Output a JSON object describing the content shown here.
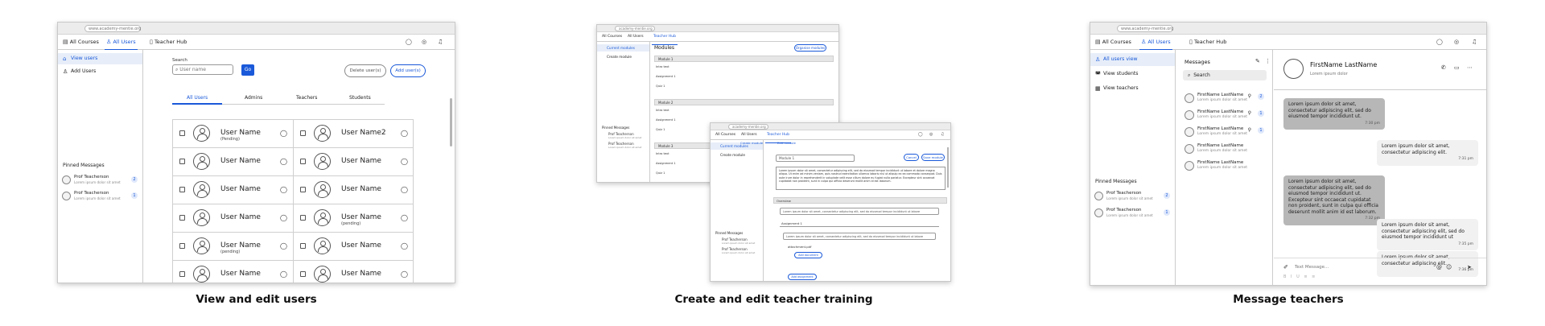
{
  "panels": [
    {
      "caption": "View and edit users"
    },
    {
      "caption": "Create and edit teacher training"
    },
    {
      "caption": "Message teachers"
    }
  ],
  "browser": {
    "url": "www.academy-mentie.org"
  },
  "topnav": {
    "all_courses": "All Courses",
    "all_users": "All Users",
    "teacher_hub": "Teacher Hub"
  },
  "users_panel": {
    "sidebar": {
      "view_users": "View users",
      "add_users": "Add Users"
    },
    "pinned_title": "Pinned Messages",
    "pinned": [
      {
        "name": "Prof Teacherson",
        "sub": "Lorem ipsum dolor sit amet",
        "count": "2"
      },
      {
        "name": "Prof Teacherson",
        "sub": "Lorem ipsum dolor sit amet",
        "count": "1"
      }
    ],
    "search_label": "Search",
    "search_placeholder": "User name",
    "go": "Go",
    "delete_btn": "Delete user(s)",
    "add_btn": "Add user(s)",
    "subtabs": [
      "All Users",
      "Admins",
      "Teachers",
      "Students"
    ],
    "left_col": [
      {
        "name": "User Name",
        "status": "(Pending)"
      },
      {
        "name": "User Name",
        "status": ""
      },
      {
        "name": "User Name",
        "status": ""
      },
      {
        "name": "User Name",
        "status": ""
      },
      {
        "name": "User Name",
        "status": "(pending)"
      },
      {
        "name": "User Name",
        "status": ""
      }
    ],
    "right_col": [
      {
        "name": "User Name2",
        "status": ""
      },
      {
        "name": "User Name",
        "status": ""
      },
      {
        "name": "User Name",
        "status": ""
      },
      {
        "name": "User Name",
        "status": "(pending)"
      },
      {
        "name": "User Name",
        "status": ""
      },
      {
        "name": "User Name",
        "status": ""
      }
    ]
  },
  "training_panel": {
    "back": {
      "url": "academy-mentie.org",
      "nav": [
        "All Courses",
        "All Users",
        "Teacher Hub"
      ],
      "sidebar": [
        "Current modules",
        "Create module"
      ],
      "title": "Modules",
      "action": "Organise modules",
      "modules": [
        "Module 1",
        "Module 2",
        "Module 3"
      ],
      "fields": [
        "Intro text",
        "Assignment 1",
        "Quiz 1"
      ],
      "pinned_title": "Pinned Messages",
      "pinned": [
        {
          "name": "Prof Teacherson",
          "sub": "Lorem ipsum dolor sit amet"
        },
        {
          "name": "Prof Teacherson",
          "sub": "Lorem ipsum dolor sit amet"
        }
      ]
    },
    "front": {
      "url": "academy-mentie.org",
      "nav": [
        "All Courses",
        "All Users",
        "Teacher Hub"
      ],
      "sidebar": [
        "Current modules",
        "Create module"
      ],
      "crumbs": [
        "Create module",
        "Edit module"
      ],
      "module_name": "Module 1",
      "cancel": "Cancel",
      "save": "Save module",
      "description": "Lorem ipsum dolor sit amet, consectetur adipiscing elit, sed do eiusmod tempor incididunt ut labore et dolore magna aliqua. Ut enim ad minim veniam, quis nostrud exercitation ullamco laboris nisi ut aliquip ex ea commodo consequat. Duis aute irure dolor in reprehenderit in voluptate velit esse cillum dolore eu fugiat nulla pariatur. Excepteur sint occaecat cupidatat non proident, sunt in culpa qui officia deserunt mollit anim id est laborum.",
      "section": "Overview",
      "intro_text": "Lorem ipsum dolor sit amet, consectetur adipiscing elit, sed do eiusmod tempor incididunt ut labore",
      "assignment": "Assignment 1",
      "assignment_text": "Lorem ipsum dolor sit amet, consectetur adipiscing elit, sed do eiusmod tempor incididunt ut labore",
      "attachment": "attachment.pdf",
      "add_document": "Add document",
      "add_another": "Add assignment",
      "pinned_title": "Pinned Messages",
      "pinned": [
        {
          "name": "Prof Teacherson",
          "sub": "Lorem ipsum dolor sit amet"
        },
        {
          "name": "Prof Teacherson",
          "sub": "Lorem ipsum dolor sit amet"
        }
      ]
    }
  },
  "messages_panel": {
    "sidebar": {
      "all_users": "All users view",
      "view_students": "View students",
      "view_teachers": "View teachers"
    },
    "pinned_title": "Pinned Messages",
    "pinned": [
      {
        "name": "Prof Teacherson",
        "sub": "Lorem ipsum dolor sit amet",
        "count": "2"
      },
      {
        "name": "Prof Teacherson",
        "sub": "Lorem ipsum dolor sit amet",
        "count": "1"
      }
    ],
    "list_title": "Messages",
    "search": "Search",
    "conversations": [
      {
        "name": "FirstName LastName",
        "sub": "Lorem ipsum dolor sit amet",
        "count": "2"
      },
      {
        "name": "FirstName LastName",
        "sub": "Lorem ipsum dolor sit amet",
        "count": "1"
      },
      {
        "name": "FirstName LastName",
        "sub": "Lorem ipsum dolor sit amet",
        "count": "1"
      },
      {
        "name": "FirstName LastName",
        "sub": "Lorem ipsum dolor sit amet",
        "count": ""
      },
      {
        "name": "FirstName LastName",
        "sub": "Lorem ipsum dolor sit amet",
        "count": ""
      }
    ],
    "chat_name": "FirstName LastName",
    "chat_sub": "Lorem ipsum dolor",
    "bubbles": [
      {
        "dir": "in",
        "text": "Lorem ipsum dolor sit amet, consectetur adipiscing elit, sed do eiusmod tempor incididunt ut.",
        "time": "7:30 pm"
      },
      {
        "dir": "out",
        "text": "Lorem ipsum dolor sit amet, consectetur adipiscing elit.",
        "time": "7:31 pm"
      },
      {
        "dir": "in",
        "text": "Lorem ipsum dolor sit amet, consectetur adipiscing elit, sed do eiusmod tempor incididunt ut. Excepteur sint occaecat cupidatat non proident, sunt in culpa qui officia deserunt mollit anim id est laborum.",
        "time": "7:32 pm"
      },
      {
        "dir": "out",
        "text": "Lorem ipsum dolor sit amet, consectetur adipiscing elit, sed do eiusmod tempor incididunt ut",
        "time": "7:35 pm"
      },
      {
        "dir": "out",
        "text": "Lorem ipsum dolor sit amet, consectetur adipiscing elit.",
        "time": "7:36 pm"
      }
    ],
    "composer": "Text Message..."
  }
}
